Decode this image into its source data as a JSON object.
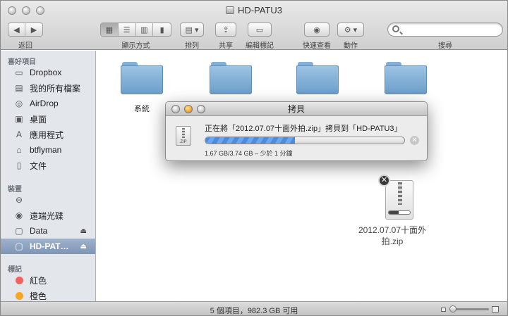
{
  "window": {
    "title": "HD-PATU3"
  },
  "toolbar": {
    "back_label": "返回",
    "view_label": "顯示方式",
    "arrange_label": "排列",
    "share_label": "共享",
    "tags_label": "編輯標記",
    "quicklook_label": "快速查看",
    "action_label": "動作",
    "search_label": "搜尋",
    "search_value": "",
    "search_placeholder": ""
  },
  "sidebar": {
    "favorites_header": "喜好項目",
    "favorites": [
      {
        "label": "Dropbox",
        "icon": "folder-icon"
      },
      {
        "label": "我的所有檔案",
        "icon": "all-files-icon"
      },
      {
        "label": "AirDrop",
        "icon": "airdrop-icon"
      },
      {
        "label": "桌面",
        "icon": "desktop-icon"
      },
      {
        "label": "應用程式",
        "icon": "applications-icon"
      },
      {
        "label": "btflyman",
        "icon": "home-icon"
      },
      {
        "label": "文件",
        "icon": "documents-icon"
      }
    ],
    "devices_header": "裝置",
    "devices": [
      {
        "label": "",
        "icon": "drive-icon"
      },
      {
        "label": "遠端光碟",
        "icon": "remote-disc-icon"
      },
      {
        "label": "Data",
        "icon": "disk-icon"
      },
      {
        "label": "HD-PAT…",
        "icon": "disk-icon"
      }
    ],
    "tags_header": "標記",
    "tags": [
      {
        "label": "紅色",
        "color": "#f2625c"
      },
      {
        "label": "橙色",
        "color": "#f6a623"
      }
    ]
  },
  "content": {
    "items": [
      {
        "label": "系統"
      },
      {
        "label": ""
      },
      {
        "label": ""
      },
      {
        "label": ""
      }
    ],
    "copying_file": {
      "label_line1": "2012.07.07十面外",
      "label_line2": "拍.zip"
    }
  },
  "copy_dialog": {
    "title": "拷貝",
    "message": "正在將「2012.07.07十面外拍.zip」拷貝到「HD-PATU3」",
    "progress_fraction": 0.45,
    "detail": "1.67 GB/3.74 GB – 少於 1 分鐘",
    "file_icon_text": "ZIP"
  },
  "statusbar": {
    "text": "5 個項目，982.3 GB 可用"
  }
}
